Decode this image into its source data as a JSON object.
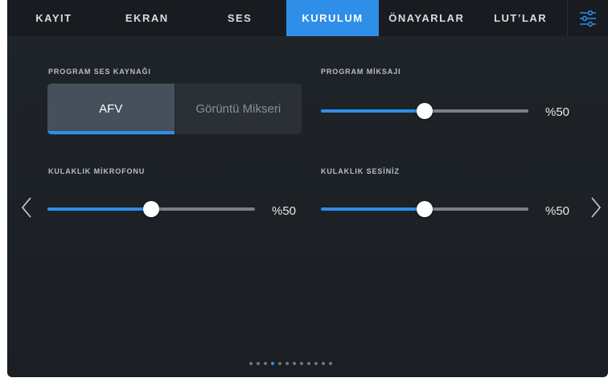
{
  "tabs": [
    {
      "label": "KAYIT",
      "active": false
    },
    {
      "label": "EKRAN",
      "active": false
    },
    {
      "label": "SES",
      "active": false
    },
    {
      "label": "KURULUM",
      "active": true
    },
    {
      "label": "ÖNAYARLAR",
      "active": false
    },
    {
      "label": "LUT’LAR",
      "active": false
    }
  ],
  "menu_icon": "sliders-menu-icon",
  "program_audio_source": {
    "label": "PROGRAM SES KAYNAĞI",
    "options": [
      "AFV",
      "Görüntü Mikseri"
    ],
    "selected": "AFV"
  },
  "program_mix": {
    "label": "PROGRAM MİKSAJI",
    "value_text": "%50",
    "level": 0.5
  },
  "headset_mic": {
    "label": "KULAKLIK MİKROFONU",
    "value_text": "%50",
    "level": 0.5
  },
  "headset_volume": {
    "label": "KULAKLIK SESİNİZ",
    "value_text": "%50",
    "level": 0.5
  },
  "navigation": {
    "prev_icon": "chevron-left-icon",
    "next_icon": "chevron-right-icon"
  },
  "pagination": {
    "total": 12,
    "current": 4
  },
  "colors": {
    "accent": "#2e8ee8",
    "background": "#1d2126",
    "tabbar": "#181b1f"
  }
}
